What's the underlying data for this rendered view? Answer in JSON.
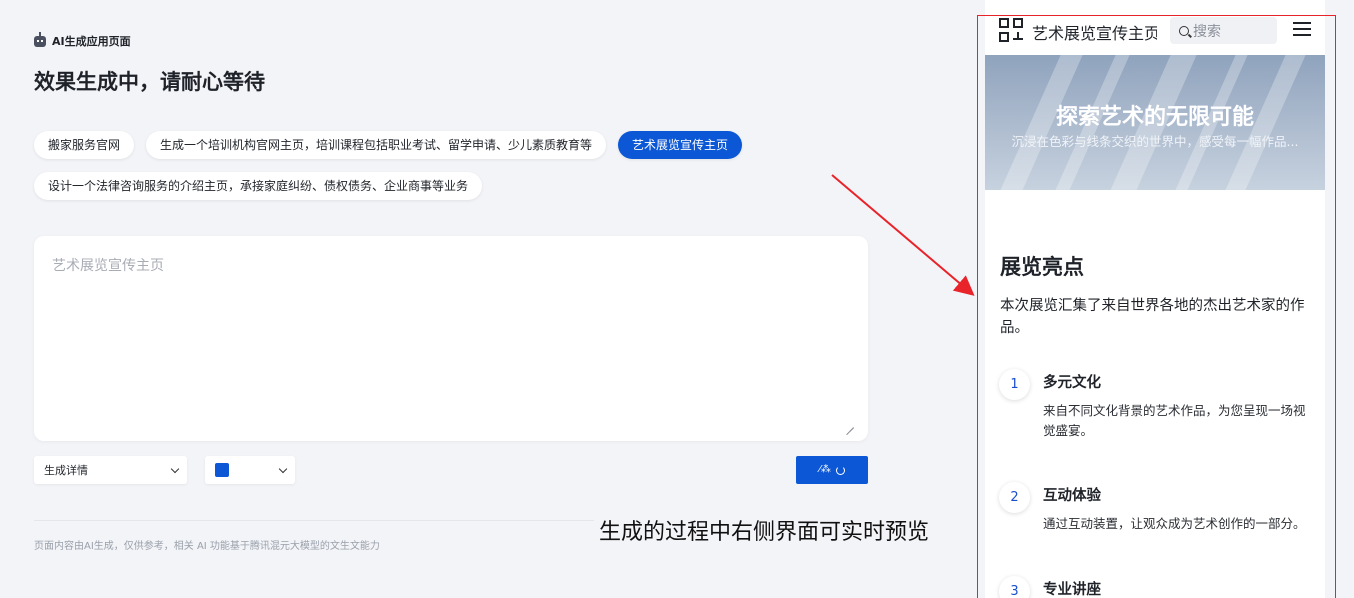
{
  "left": {
    "brand_label": "AI生成应用页面",
    "page_title": "效果生成中，请耐心等待",
    "prompt_chips": [
      {
        "label": "搬家服务官网",
        "active": false
      },
      {
        "label": "生成一个培训机构官网主页，培训课程包括职业考试、留学申请、少儿素质教育等",
        "active": false
      },
      {
        "label": "艺术展览宣传主页",
        "active": true
      },
      {
        "label": "设计一个法律咨询服务的介绍主页，承接家庭纠纷、债权债务、企业商事等业务",
        "active": false
      }
    ],
    "input_placeholder": "艺术展览宣传主页",
    "mode_select": {
      "value": "生成详情"
    },
    "color_select": {
      "value": "#0b57d6"
    },
    "footnote": "页面内容由AI生成，仅供参考，相关 AI 功能基于腾讯混元大模型的文生文能力"
  },
  "annotation": "生成的过程中右侧界面可实时预览",
  "preview": {
    "nav_title": "艺术展览宣传主页",
    "search_placeholder": "搜索",
    "hero": {
      "title": "探索艺术的无限可能",
      "subtitle": "沉浸在色彩与线条交织的世界中，感受每一幅作品..."
    },
    "highlights": {
      "title": "展览亮点",
      "description": "本次展览汇集了来自世界各地的杰出艺术家的作品。",
      "items": [
        {
          "number": "1",
          "title": "多元文化",
          "desc": "来自不同文化背景的艺术作品，为您呈现一场视觉盛宴。"
        },
        {
          "number": "2",
          "title": "互动体验",
          "desc": "通过互动装置，让观众成为艺术创作的一部分。"
        },
        {
          "number": "3",
          "title": "专业讲座",
          "desc": ""
        }
      ]
    }
  },
  "colors": {
    "accent": "#0b57d6",
    "page_bg": "#f3f4f8",
    "annotation_red": "#e8232a"
  },
  "icons": [
    "robot-icon",
    "chevron-down-icon",
    "magic-wand-icon",
    "loading-spinner-icon",
    "app-grid-logo-icon",
    "search-icon",
    "hamburger-menu-icon",
    "annotation-arrow"
  ]
}
